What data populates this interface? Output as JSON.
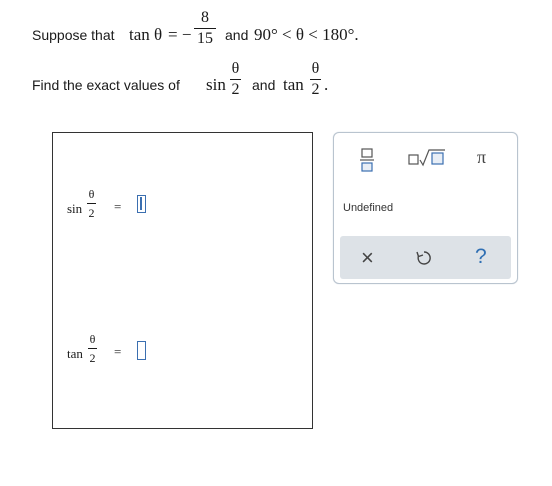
{
  "problem": {
    "line1_prefix": "Suppose that",
    "line1_fn": "tan θ",
    "line1_eq": "= −",
    "tan_num": "8",
    "tan_den": "15",
    "line1_and": "and",
    "line1_range": "90° < θ < 180°.",
    "line2_prefix": "Find the exact values of",
    "sin_label": "sin",
    "theta": "θ",
    "two": "2",
    "line2_and": "and",
    "tan_label": "tan",
    "period": "."
  },
  "answers": {
    "row1_fn": "sin",
    "row1_eq": "=",
    "row2_fn": "tan",
    "row2_eq": "=",
    "theta": "θ",
    "two": "2"
  },
  "keypad": {
    "fraction_icon": "fraction-icon",
    "sqrt_icon": "square-root-icon",
    "pi_label": "π",
    "undefined_label": "Undefined",
    "clear_label": "×",
    "undo_icon": "undo-icon",
    "help_label": "?"
  },
  "colors": {
    "accent": "#3b6fb0",
    "panel_bottom": "#dde2e7",
    "panel_border": "#b9c4cf"
  }
}
